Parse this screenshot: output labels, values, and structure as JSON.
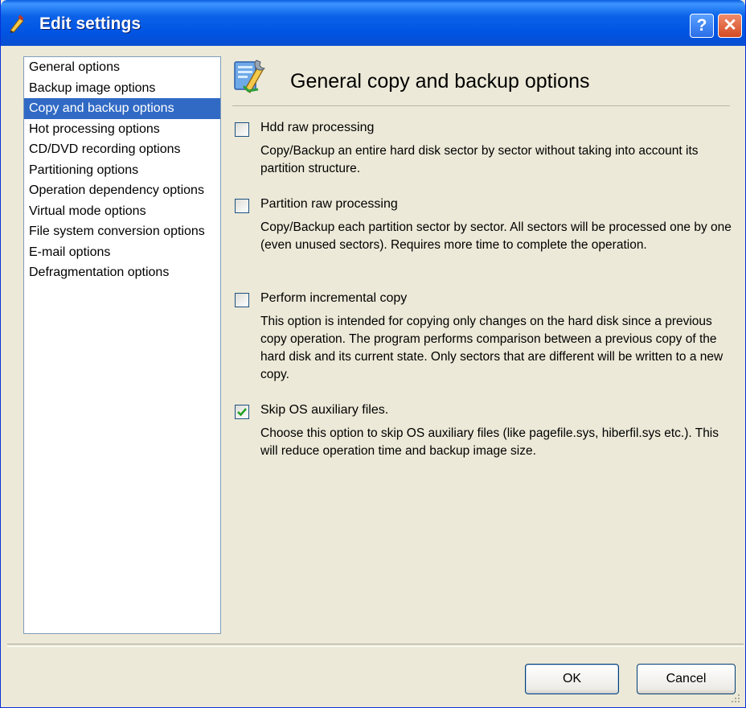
{
  "window": {
    "title": "Edit settings",
    "help_label": "?",
    "close_label": "✕"
  },
  "nav": {
    "items": [
      {
        "label": "General options"
      },
      {
        "label": "Backup image options"
      },
      {
        "label": "Copy and backup options"
      },
      {
        "label": "Hot processing options"
      },
      {
        "label": "CD/DVD recording options"
      },
      {
        "label": "Partitioning options"
      },
      {
        "label": "Operation dependency options"
      },
      {
        "label": "Virtual mode options"
      },
      {
        "label": "File system conversion options"
      },
      {
        "label": "E-mail options"
      },
      {
        "label": "Defragmentation options"
      }
    ],
    "selected_index": 2
  },
  "section": {
    "title": "General copy and backup options"
  },
  "options": [
    {
      "label": "Hdd raw processing",
      "checked": false,
      "description": "Copy/Backup an entire hard disk sector by sector without taking into account its partition structure."
    },
    {
      "label": "Partition raw processing",
      "checked": false,
      "description": "Copy/Backup each partition sector by sector. All sectors will be processed one by one (even unused sectors). Requires more time to complete the operation."
    },
    {
      "label": "Perform incremental copy",
      "checked": false,
      "description": "This option is intended for copying only changes on the hard disk since a previous copy operation. The program performs comparison between a previous copy of the hard disk and its current state. Only sectors that are different will be written to a new copy."
    },
    {
      "label": "Skip OS auxiliary files.",
      "checked": true,
      "description": "Choose this option to skip OS auxiliary files (like pagefile.sys, hiberfil.sys etc.). This will reduce operation time and backup image size."
    }
  ],
  "buttons": {
    "ok_label": "OK",
    "cancel_label": "Cancel"
  },
  "colors": {
    "titlebar": "#0054e3",
    "selection": "#316ac5",
    "dialog_bg": "#ece9d8",
    "checkmark": "#21a121"
  }
}
